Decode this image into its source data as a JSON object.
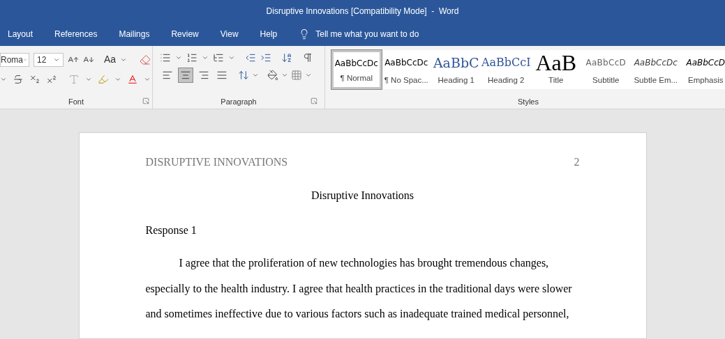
{
  "window": {
    "title": "Disruptive Innovations [Compatibility Mode]  -  Word"
  },
  "menu_tabs": [
    {
      "label": "Layout",
      "selected": false
    },
    {
      "label": "References",
      "selected": false
    },
    {
      "label": "Mailings",
      "selected": false
    },
    {
      "label": "Review",
      "selected": false
    },
    {
      "label": "View",
      "selected": false
    },
    {
      "label": "Help",
      "selected": false
    }
  ],
  "tell_me": {
    "placeholder": "Tell me what you want to do"
  },
  "font_group": {
    "label": "Font",
    "font_name": "Roma",
    "font_size": "12",
    "change_case": "Aa"
  },
  "paragraph_group": {
    "label": "Paragraph",
    "alignments": [
      {
        "kind": "left",
        "selected": false
      },
      {
        "kind": "center",
        "selected": true
      },
      {
        "kind": "right",
        "selected": false
      },
      {
        "kind": "justify",
        "selected": false
      }
    ]
  },
  "styles_group": {
    "label": "Styles",
    "styles": [
      {
        "preview": "AaBbCcDc",
        "name": "¶ Normal",
        "kind": "normal",
        "selected": true
      },
      {
        "preview": "AaBbCcDc",
        "name": "¶ No Spac...",
        "kind": "normal",
        "selected": false
      },
      {
        "preview": "AaBbC",
        "name": "Heading 1",
        "kind": "heading1",
        "selected": false
      },
      {
        "preview": "AaBbCcI",
        "name": "Heading 2",
        "kind": "heading2",
        "selected": false
      },
      {
        "preview": "AaB",
        "name": "Title",
        "kind": "title",
        "selected": false
      },
      {
        "preview": "AaBbCcD",
        "name": "Subtitle",
        "kind": "subtitle",
        "selected": false
      },
      {
        "preview": "AaBbCcDc",
        "name": "Subtle Em...",
        "kind": "italic",
        "selected": false
      },
      {
        "preview": "AaBbCcD",
        "name": "Emphasis",
        "kind": "italicbold",
        "selected": false
      }
    ]
  },
  "document": {
    "header": "DISRUPTIVE INNOVATIONS",
    "page_number": "2",
    "title": "Disruptive Innovations",
    "section": "Response 1",
    "paragraph_lines": [
      "I agree that the proliferation of new technologies has brought tremendous changes,",
      "especially to the health industry. I agree that health practices in the traditional days were slower",
      "and sometimes ineffective due to various factors such as inadequate trained medical personnel,"
    ]
  }
}
